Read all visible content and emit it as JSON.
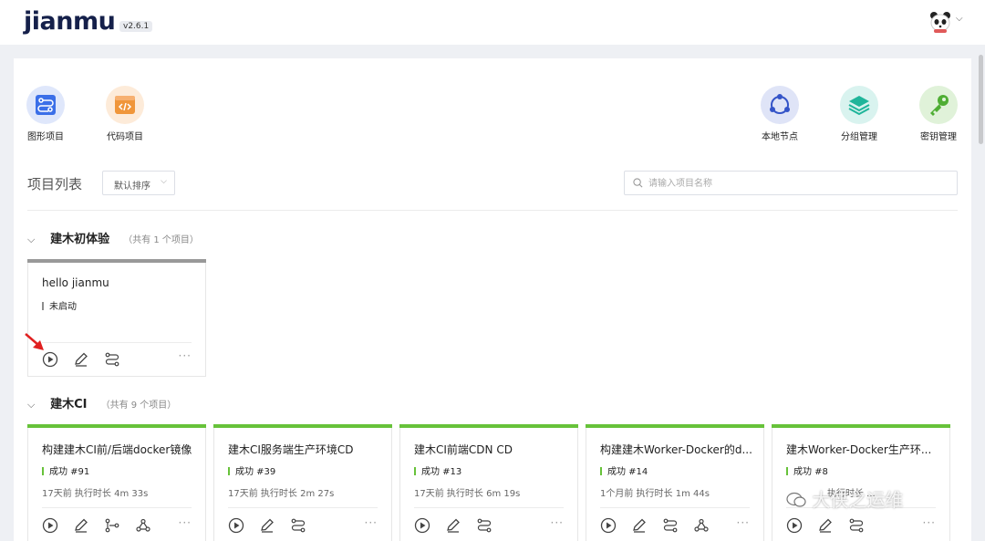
{
  "header": {
    "logo": "jianmu",
    "version": "v2.6.1"
  },
  "tools_left": [
    {
      "label": "图形项目",
      "icon": "graph-project-icon"
    },
    {
      "label": "代码项目",
      "icon": "code-project-icon"
    }
  ],
  "tools_right": [
    {
      "label": "本地节点",
      "icon": "local-node-icon"
    },
    {
      "label": "分组管理",
      "icon": "group-manage-icon"
    },
    {
      "label": "密钥管理",
      "icon": "key-manage-icon"
    }
  ],
  "list": {
    "title": "项目列表",
    "sort_label": "默认排序",
    "search_placeholder": "请输入项目名称"
  },
  "groups": [
    {
      "name": "建木初体验",
      "count": "（共有 1 个项目）",
      "projects": [
        {
          "name": "hello jianmu",
          "status": "未启动",
          "status_color": "#8c8c8c",
          "meta": ""
        }
      ]
    },
    {
      "name": "建木CI",
      "count": "（共有 9 个项目）",
      "projects": [
        {
          "name": "构建建木CI前/后端docker镜像",
          "status": "成功 #91",
          "status_color": "#67c23a",
          "meta": "17天前 执行时长 4m 33s"
        },
        {
          "name": "建木CI服务端生产环境CD",
          "status": "成功 #39",
          "status_color": "#67c23a",
          "meta": "17天前 执行时长 2m 27s"
        },
        {
          "name": "建木CI前端CDN CD",
          "status": "成功 #13",
          "status_color": "#67c23a",
          "meta": "17天前 执行时长 6m 19s"
        },
        {
          "name": "构建建木Worker-Docker的d...",
          "status": "成功 #14",
          "status_color": "#67c23a",
          "meta": "1个月前 执行时长 1m 44s"
        },
        {
          "name": "建木Worker-Docker生产环...",
          "status": "成功 #8",
          "status_color": "#67c23a",
          "meta": "执行时长 ..."
        }
      ]
    }
  ],
  "more_label": "···",
  "watermark": "大侠之运维"
}
